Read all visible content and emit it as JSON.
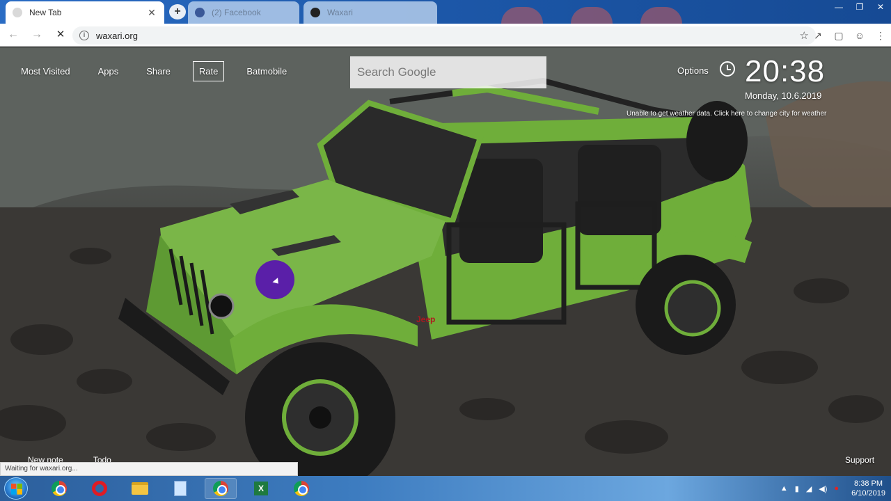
{
  "browser": {
    "tabs": [
      {
        "title": "New Tab",
        "active": true
      },
      {
        "title": "(2) Facebook",
        "active": false
      },
      {
        "title": "Waxari",
        "active": false
      }
    ],
    "url": "waxari.org",
    "status": "Waiting for waxari.org..."
  },
  "newtab": {
    "nav": [
      "Most Visited",
      "Apps",
      "Share",
      "Rate",
      "Batmobile"
    ],
    "search_placeholder": "Search Google",
    "options": "Options",
    "time": "20:38",
    "date": "Monday, 10.6.2019",
    "weather": "Unable to get weather data. Click here to change city for weather",
    "bottom_links": [
      "New note",
      "Todo"
    ],
    "support": "Support"
  },
  "taskbar": {
    "time": "8:38 PM",
    "date": "6/10/2019"
  },
  "colors": {
    "jeep_green": "#6fae3a",
    "cursor_purple": "#5a1fa8",
    "tab_bar_blue": "#1e5fb4"
  }
}
